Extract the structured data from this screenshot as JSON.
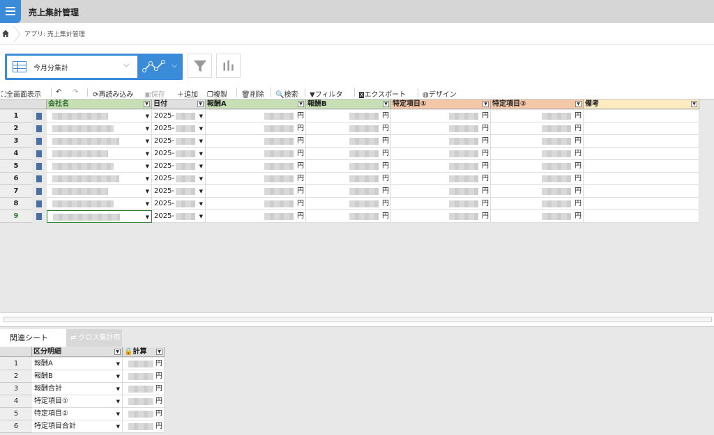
{
  "app": {
    "title": "売上集計管理"
  },
  "breadcrumb": {
    "text": "アプリ: 売上集計管理"
  },
  "view": {
    "selected": "今月分集計"
  },
  "toolbar": {
    "fullscreen": "全画面表示",
    "reload": "再読み込み",
    "save": "保存",
    "add": "追加",
    "duplicate": "複製",
    "delete": "削除",
    "search": "検索",
    "filter": "フィルタ",
    "export": "エクスポート",
    "design": "デザイン"
  },
  "table": {
    "columns": [
      "会社名",
      "日付",
      "報酬A",
      "報酬B",
      "特定項目①",
      "特定項目②",
      "備考"
    ],
    "row_numbers": [
      "1",
      "2",
      "3",
      "4",
      "5",
      "6",
      "7",
      "8",
      "9"
    ],
    "date_prefix": "2025-",
    "currency": "円"
  },
  "bottom": {
    "tabs": [
      "関連シート",
      "クロス集計用"
    ],
    "columns": [
      "区分明細",
      "計算"
    ],
    "rows": [
      {
        "num": "1",
        "label": "報酬A"
      },
      {
        "num": "2",
        "label": "報酬B"
      },
      {
        "num": "3",
        "label": "報酬合計"
      },
      {
        "num": "4",
        "label": "特定項目①"
      },
      {
        "num": "5",
        "label": "特定項目②"
      },
      {
        "num": "6",
        "label": "特定項目合計"
      }
    ],
    "currency": "円"
  },
  "colors": {
    "accent": "#3a8bd8",
    "header_green": "#c6dfb4",
    "header_orange": "#f4c7a9",
    "header_yellow": "#fdebc2"
  }
}
